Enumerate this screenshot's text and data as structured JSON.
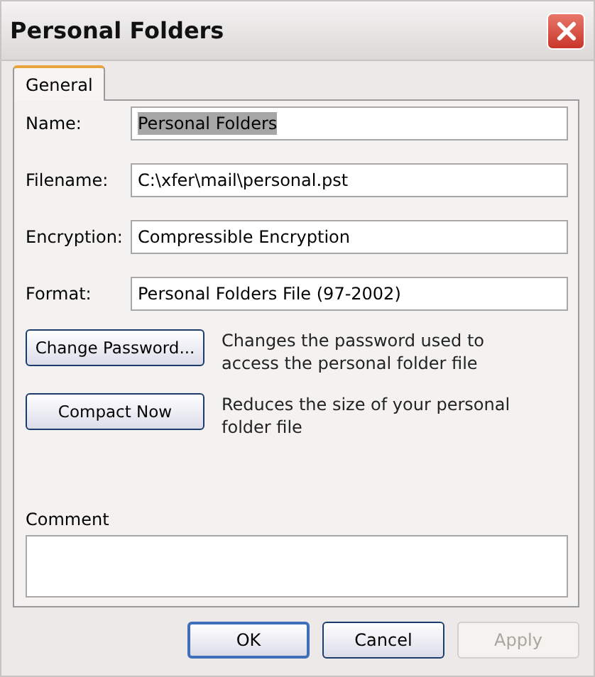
{
  "window": {
    "title": "Personal Folders"
  },
  "tabs": [
    {
      "label": "General",
      "selected": true
    }
  ],
  "fields": [
    {
      "label": "Name:",
      "value": "Personal Folders",
      "text_selected": true
    },
    {
      "label": "Filename:",
      "value": "C:\\xfer\\mail\\personal.pst",
      "text_selected": false
    },
    {
      "label": "Encryption:",
      "value": "Compressible Encryption",
      "text_selected": false
    },
    {
      "label": "Format:",
      "value": "Personal Folders File (97-2002)",
      "text_selected": false
    }
  ],
  "actions": [
    {
      "button": "Change Password...",
      "description": "Changes the password used to access the personal folder file"
    },
    {
      "button": "Compact Now",
      "description": "Reduces the size of your personal folder file"
    }
  ],
  "comment": {
    "label": "Comment"
  },
  "buttons": [
    {
      "label": "OK",
      "default": true,
      "disabled": false
    },
    {
      "label": "Cancel",
      "default": false,
      "disabled": false
    },
    {
      "label": "Apply",
      "default": false,
      "disabled": true
    }
  ]
}
